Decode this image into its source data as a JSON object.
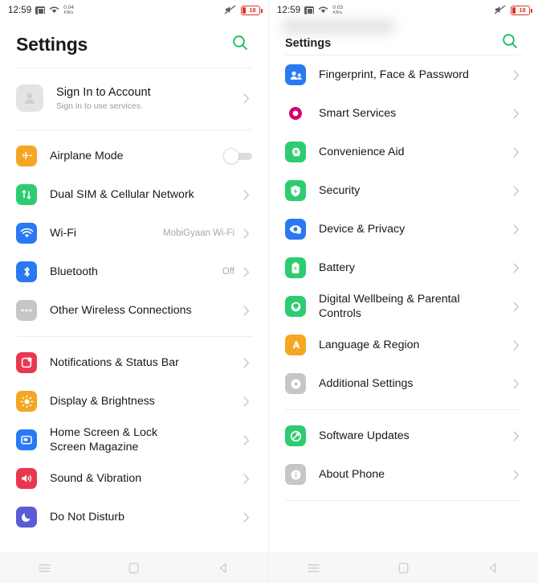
{
  "statusbar": {
    "time": "12:59",
    "speed_value_left": "0.04",
    "speed_value_right": "0.03",
    "speed_unit": "KB/s",
    "battery_level": "18",
    "icons": [
      "screenshot-icon",
      "wifi-icon",
      "network-speed",
      "silent-mode-icon",
      "battery-icon"
    ]
  },
  "colors": {
    "accent_green": "#14b866",
    "battery_red": "#e0322b",
    "blue": "#1a73e8",
    "green": "#2ecc71",
    "orange": "#f5a623",
    "red": "#e8384f",
    "purple": "#5b5bd6",
    "grey": "#c6c6c8",
    "magenta": "#d6006e"
  },
  "left": {
    "header": {
      "title": "Settings",
      "search_icon": "search-icon"
    },
    "account": {
      "title": "Sign In to Account",
      "subtitle": "Sign in to use services.",
      "avatar_icon": "avatar-placeholder-icon"
    },
    "groups": [
      {
        "items": [
          {
            "label": "Airplane Mode",
            "icon": "airplane-icon",
            "color": "#f5a623",
            "control": "toggle",
            "toggle_on": false
          },
          {
            "label": "Dual SIM & Cellular Network",
            "icon": "sim-card-icon",
            "color": "#2ecc71",
            "control": "chevron"
          },
          {
            "label": "Wi-Fi",
            "icon": "wifi-icon",
            "color": "#2979f2",
            "control": "chevron",
            "value": "MobiGyaan Wi-Fi"
          },
          {
            "label": "Bluetooth",
            "icon": "bluetooth-icon",
            "color": "#2979f2",
            "control": "chevron",
            "value": "Off"
          },
          {
            "label": "Other Wireless Connections",
            "icon": "more-dots-icon",
            "color": "#c6c6c8",
            "control": "chevron"
          }
        ]
      },
      {
        "items": [
          {
            "label": "Notifications & Status Bar",
            "icon": "notification-badge-icon",
            "color": "#e8384f",
            "control": "chevron"
          },
          {
            "label": "Display & Brightness",
            "icon": "brightness-icon",
            "color": "#f5a623",
            "control": "chevron"
          },
          {
            "label": "Home Screen & Lock Screen Magazine",
            "icon": "wallpaper-icon",
            "color": "#2979f2",
            "control": "chevron"
          },
          {
            "label": "Sound & Vibration",
            "icon": "speaker-icon",
            "color": "#e8384f",
            "control": "chevron"
          },
          {
            "label": "Do Not Disturb",
            "icon": "moon-icon",
            "color": "#5b5bd6",
            "control": "chevron"
          }
        ]
      }
    ]
  },
  "right": {
    "header": {
      "title": "Settings",
      "search_icon": "search-icon"
    },
    "groups": [
      {
        "items": [
          {
            "label": "Fingerprint, Face & Password",
            "icon": "fingerprint-face-icon",
            "color": "#2979f2",
            "control": "chevron"
          },
          {
            "label": "Smart Services",
            "icon": "smart-services-icon",
            "color": "#ffffff",
            "control": "chevron"
          },
          {
            "label": "Convenience Aid",
            "icon": "convenience-aid-icon",
            "color": "#2ecc71",
            "control": "chevron"
          },
          {
            "label": "Security",
            "icon": "shield-icon",
            "color": "#2ecc71",
            "control": "chevron"
          },
          {
            "label": "Device & Privacy",
            "icon": "privacy-eye-icon",
            "color": "#2979f2",
            "control": "chevron"
          },
          {
            "label": "Battery",
            "icon": "battery-icon",
            "color": "#2ecc71",
            "control": "chevron"
          },
          {
            "label": "Digital Wellbeing & Parental Controls",
            "icon": "wellbeing-icon",
            "color": "#2ecc71",
            "control": "chevron"
          },
          {
            "label": "Language & Region",
            "icon": "language-icon",
            "color": "#f5a623",
            "control": "chevron"
          },
          {
            "label": "Additional Settings",
            "icon": "additional-settings-icon",
            "color": "#c6c6c8",
            "control": "chevron"
          }
        ]
      },
      {
        "items": [
          {
            "label": "Software Updates",
            "icon": "update-icon",
            "color": "#2ecc71",
            "control": "chevron"
          },
          {
            "label": "About Phone",
            "icon": "info-icon",
            "color": "#c6c6c8",
            "control": "chevron"
          }
        ]
      }
    ]
  },
  "navbar": {
    "buttons": [
      {
        "name": "recents-button",
        "icon": "menu-lines-icon"
      },
      {
        "name": "home-button",
        "icon": "square-icon"
      },
      {
        "name": "back-button",
        "icon": "triangle-back-icon"
      }
    ]
  }
}
